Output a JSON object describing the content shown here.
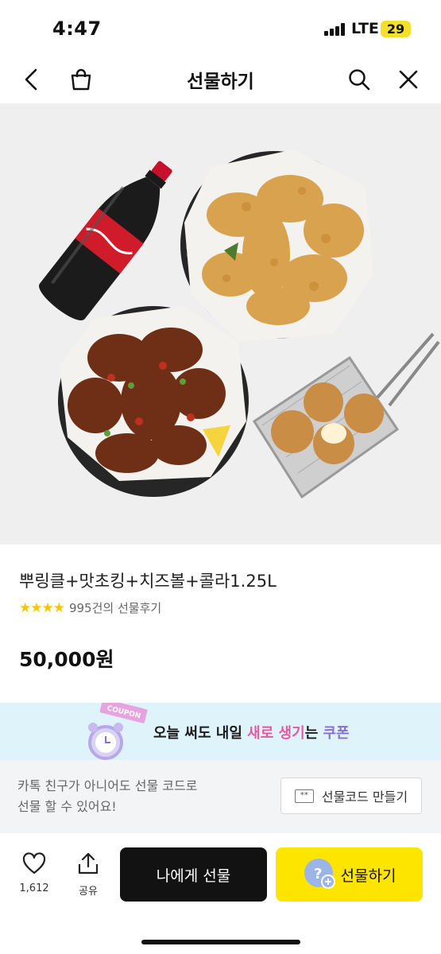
{
  "status_bar": {
    "time": "4:47",
    "network": "LTE",
    "battery": "29"
  },
  "nav": {
    "title": "선물하기",
    "back_icon": "chevron-left-icon",
    "cart_icon": "shopping-bag-icon",
    "search_icon": "search-icon",
    "close_icon": "close-icon"
  },
  "product": {
    "name": "뿌링클+맛초킹+치즈볼+콜라1.25L",
    "rating_stars": 4,
    "review_text": "995건의 선물후기",
    "price": "50,000원"
  },
  "coupon_banner": {
    "tag": "COUPON",
    "text_prefix": "오늘 써도 내일 ",
    "text_highlight1": "새로 생기",
    "text_mid": "는 ",
    "text_highlight2": "쿠폰"
  },
  "gift_code": {
    "desc_line1": "카톡 친구가 아니어도 선물 코드로",
    "desc_line2": "선물 할 수 있어요!",
    "button_label": "선물코드 만들기",
    "button_badge": "**"
  },
  "bottom_bar": {
    "like_count": "1,612",
    "share_label": "공유",
    "self_gift_label": "나에게 선물",
    "gift_label": "선물하기"
  },
  "colors": {
    "accent": "#fee500",
    "dark_button": "#121212",
    "star": "#f6c500",
    "banner": "#dff3fb"
  }
}
